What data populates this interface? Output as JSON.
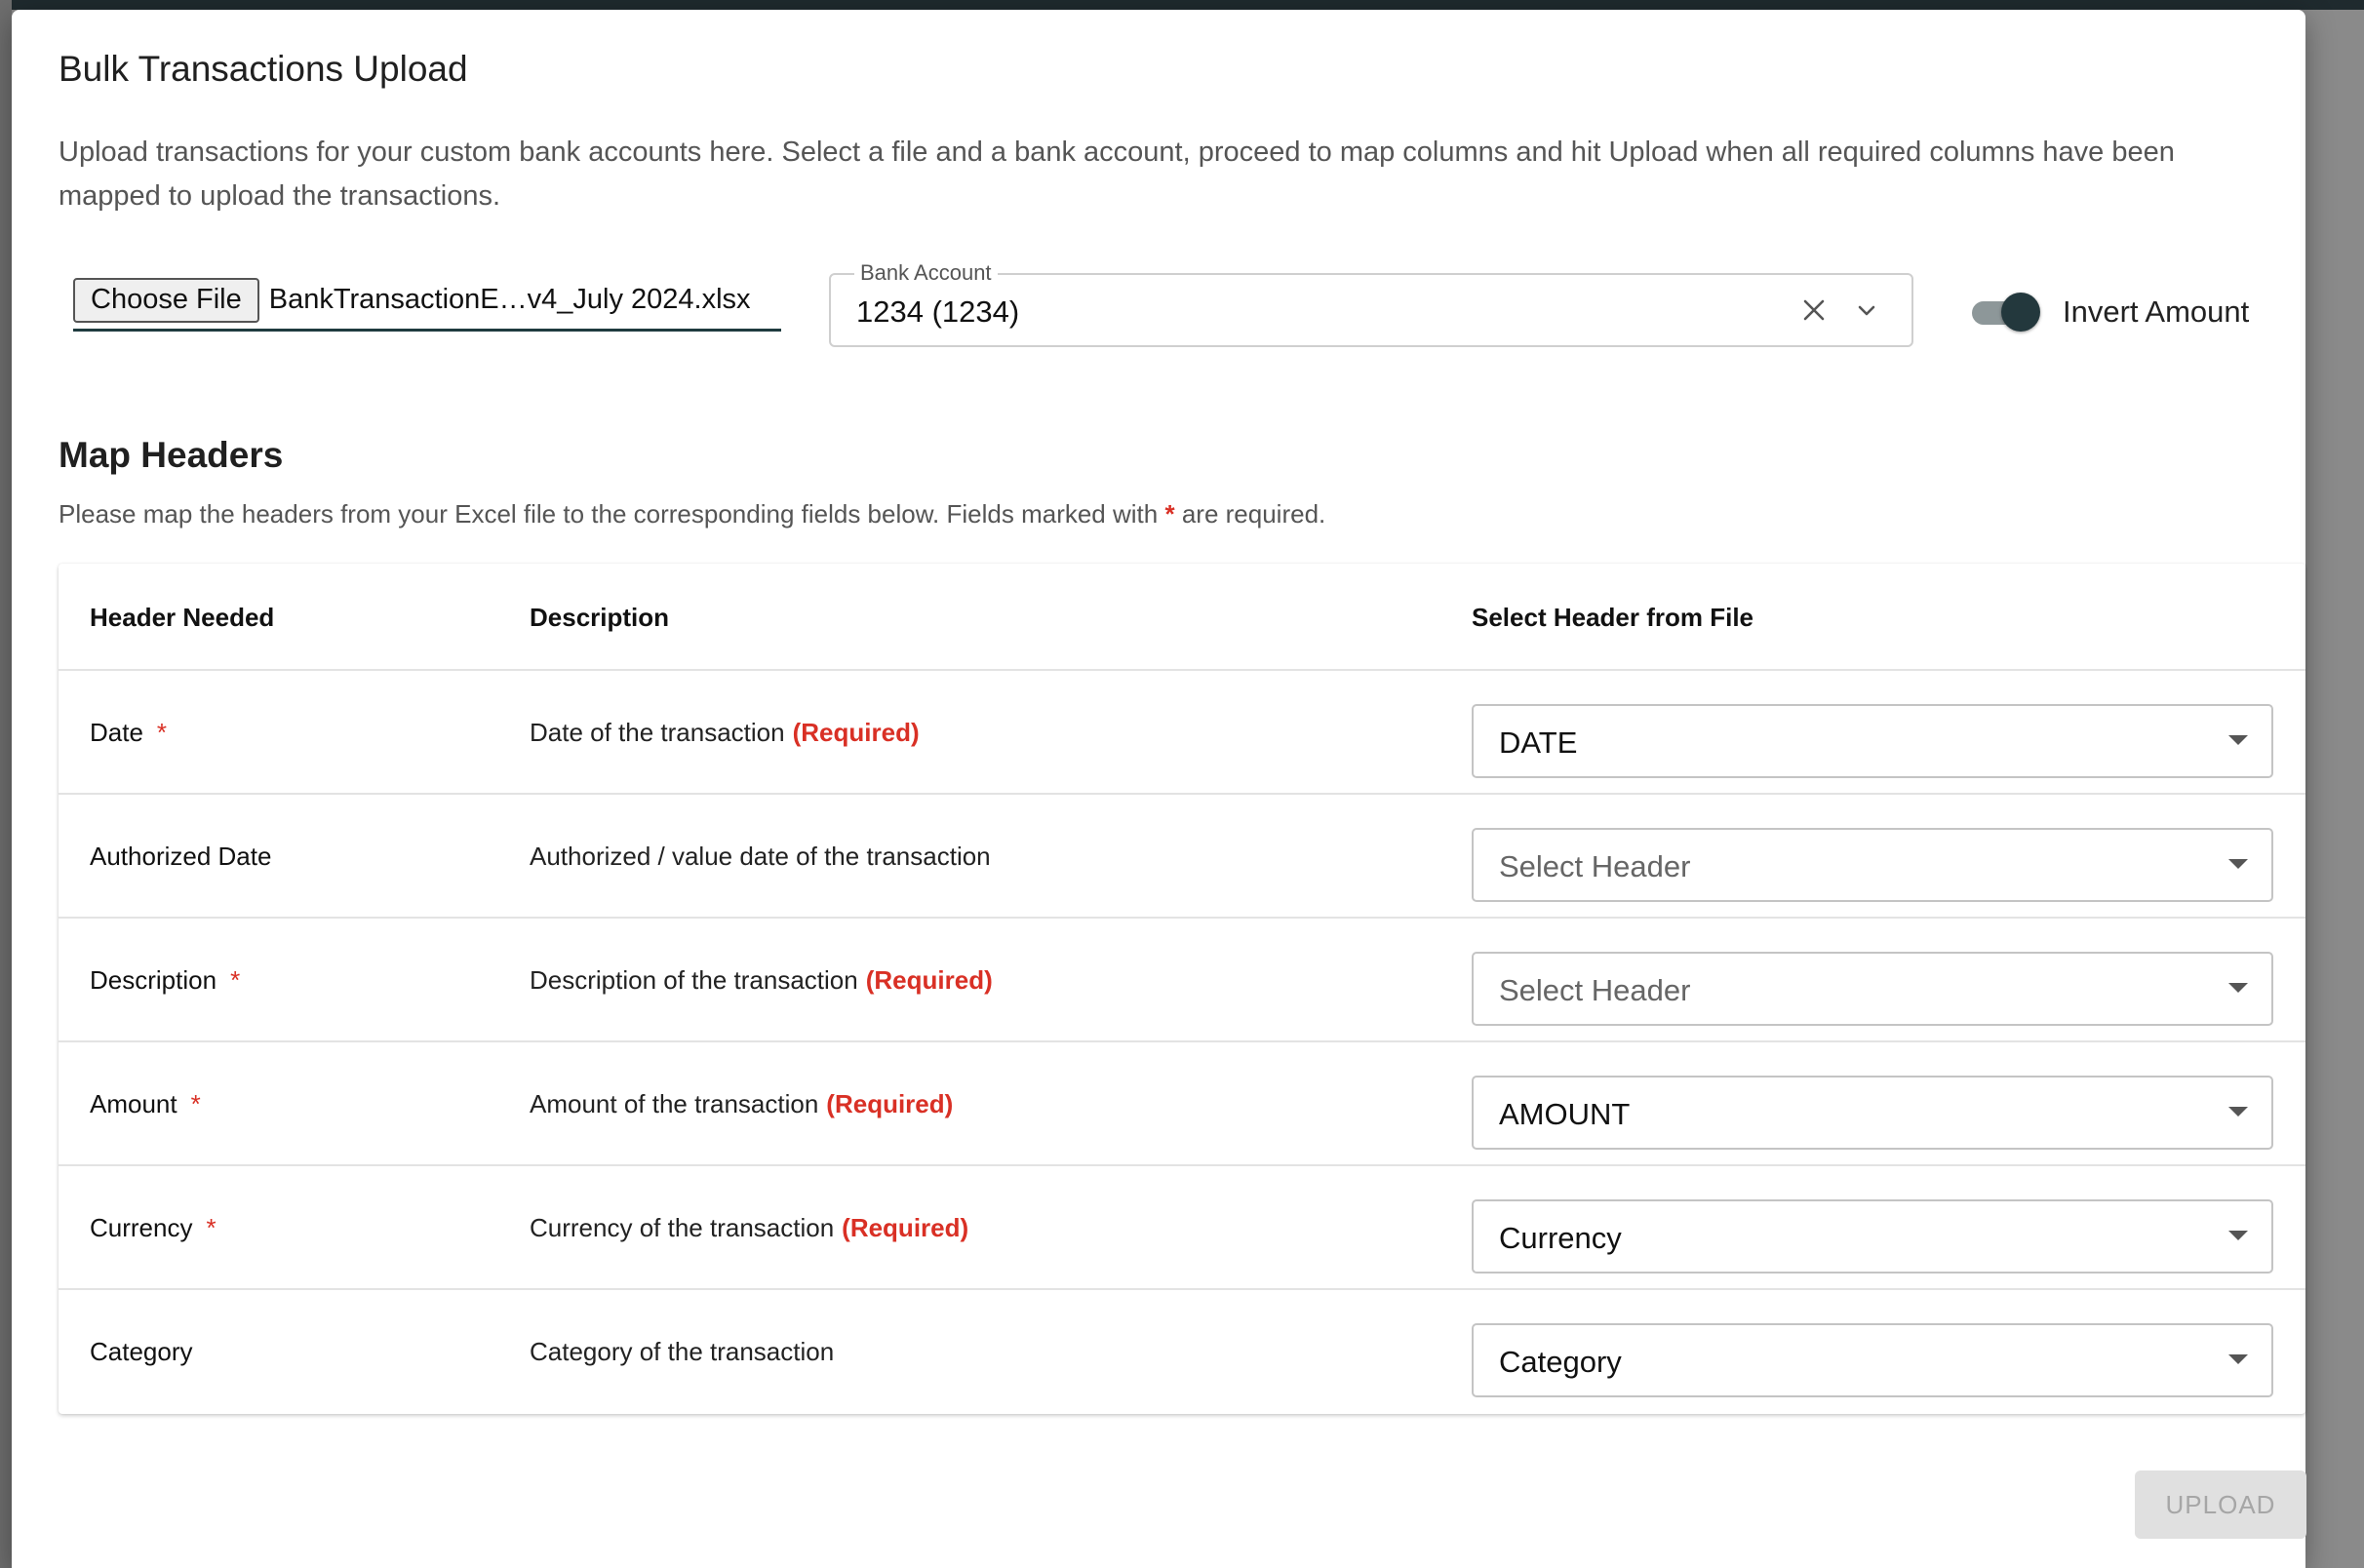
{
  "dialog": {
    "title": "Bulk Transactions Upload",
    "intro": "Upload transactions for your custom bank accounts here. Select a file and a bank account, proceed to map columns and hit Upload when all required columns have been mapped to upload the transactions."
  },
  "file_input": {
    "button_label": "Choose File",
    "file_name": "BankTransactionE…v4_July 2024.xlsx"
  },
  "bank_account": {
    "label": "Bank Account",
    "value": "1234 (1234)",
    "clear_icon": "close-icon",
    "open_icon": "chevron-down-icon"
  },
  "invert_amount": {
    "label": "Invert Amount",
    "checked": true
  },
  "map_headers": {
    "title": "Map Headers",
    "help_before": "Please map the headers from your Excel file to the corresponding fields below. Fields marked with",
    "help_star": "*",
    "help_after": "are required."
  },
  "table": {
    "columns": [
      "Header Needed",
      "Description",
      "Select Header from File"
    ],
    "required_marker": "*",
    "required_text": "(Required)",
    "rows": [
      {
        "name": "Date",
        "required": true,
        "description": "Date of the transaction",
        "selected": "DATE",
        "placeholder": false
      },
      {
        "name": "Authorized Date",
        "required": false,
        "description": "Authorized / value date of the transaction",
        "selected": "Select Header",
        "placeholder": true
      },
      {
        "name": "Description",
        "required": true,
        "description": "Description of the transaction",
        "selected": "Select Header",
        "placeholder": true
      },
      {
        "name": "Amount",
        "required": true,
        "description": "Amount of the transaction",
        "selected": "AMOUNT",
        "placeholder": false
      },
      {
        "name": "Currency",
        "required": true,
        "description": "Currency of the transaction",
        "selected": "Currency",
        "placeholder": false
      },
      {
        "name": "Category",
        "required": false,
        "description": "Category of the transaction",
        "selected": "Category",
        "placeholder": false
      }
    ]
  },
  "actions": {
    "upload_label": "UPLOAD",
    "upload_disabled": true
  },
  "colors": {
    "accent": "#23383d",
    "required": "#d93025"
  }
}
